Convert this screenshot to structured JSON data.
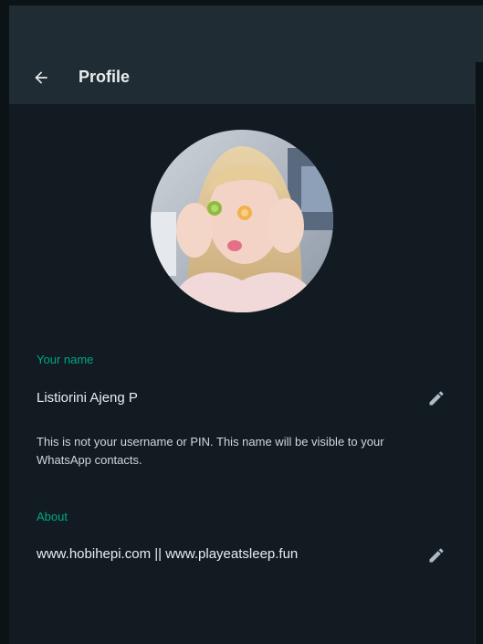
{
  "header": {
    "title": "Profile"
  },
  "name_section": {
    "label": "Your name",
    "value": "Listiorini Ajeng P",
    "hint": "This is not your username or PIN. This name will be visible to your WhatsApp contacts."
  },
  "about_section": {
    "label": "About",
    "value": "www.hobihepi.com || www.playeatsleep.fun"
  },
  "colors": {
    "accent": "#00a884",
    "panel_bg": "#111b21",
    "header_bg": "#202c33",
    "text_primary": "#e9edef",
    "icon_gray": "#aebac1"
  },
  "icons": {
    "back": "arrow-left-icon",
    "edit": "pencil-icon"
  }
}
